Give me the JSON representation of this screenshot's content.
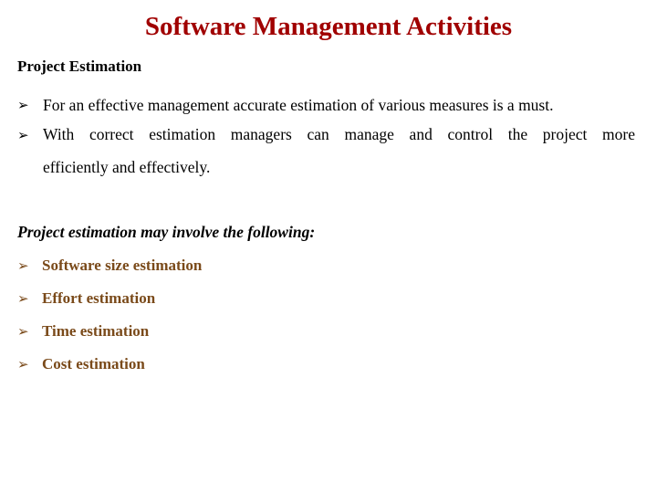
{
  "title": "Software Management Activities",
  "section_heading": "Project Estimation",
  "bullet_icon": "arrow-bullet-icon",
  "bullets": [
    "For an effective management accurate estimation of various measures is a must.",
    "With correct estimation managers can manage and control the project more",
    "efficiently and effectively."
  ],
  "intro": "Project estimation may involve the following:",
  "items": [
    "Software size estimation",
    "Effort estimation",
    "Time estimation",
    "Cost estimation"
  ],
  "colors": {
    "title": "#a00000",
    "items": "#7a4a1a",
    "text": "#000000"
  }
}
